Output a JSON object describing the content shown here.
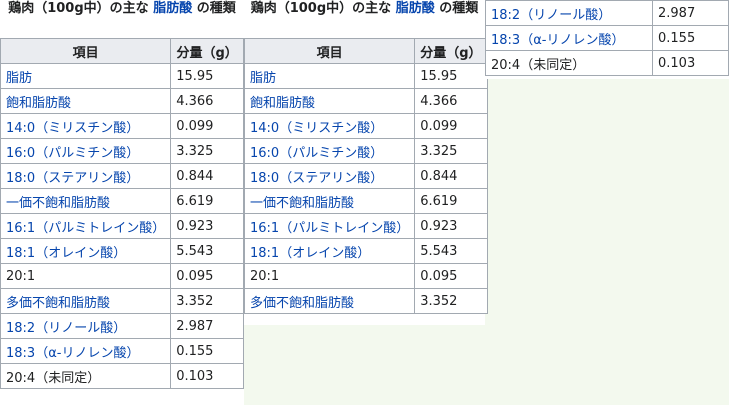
{
  "caption": {
    "before": "鶏肉（100g中）の主な",
    "link": "脂肪酸",
    "after": "の種類"
  },
  "headers": {
    "item": "項目",
    "amount": "分量（g）"
  },
  "rows": [
    {
      "item": "脂肪",
      "value": "15.95",
      "link": true
    },
    {
      "item": "飽和脂肪酸",
      "value": "4.366",
      "link": true
    },
    {
      "item": "14:0（ミリスチン酸）",
      "value": "0.099",
      "link": true
    },
    {
      "item": "16:0（パルミチン酸）",
      "value": "3.325",
      "link": true
    },
    {
      "item": "18:0（ステアリン酸）",
      "value": "0.844",
      "link": true
    },
    {
      "item": "一価不飽和脂肪酸",
      "value": "6.619",
      "link": true
    },
    {
      "item": "16:1（パルミトレイン酸）",
      "value": "0.923",
      "link": true
    },
    {
      "item": "18:1（オレイン酸）",
      "value": "5.543",
      "link": true
    },
    {
      "item": "20:1",
      "value": "0.095",
      "link": false
    },
    {
      "item": "多価不飽和脂肪酸",
      "value": "3.352",
      "link": true
    },
    {
      "item": "18:2（リノール酸）",
      "value": "2.987",
      "link": true
    },
    {
      "item": "18:3（α-リノレン酸）",
      "value": "0.155",
      "link": true
    },
    {
      "item": "20:4（未同定）",
      "value": "0.103",
      "link": false
    }
  ],
  "colors": {
    "link": "#0645ad",
    "header_bg": "#eaecf0",
    "border": "#a2a9b1",
    "page_bg": "#f3f9ee"
  }
}
